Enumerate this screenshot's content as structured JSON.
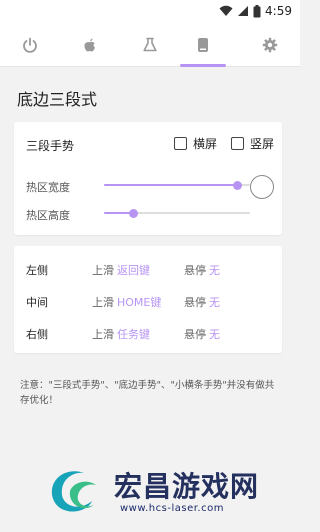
{
  "status_bar": {
    "time": "4:59"
  },
  "tabs": [
    {
      "name": "power",
      "icon": "power-icon"
    },
    {
      "name": "apple",
      "icon": "apple-icon"
    },
    {
      "name": "lab",
      "icon": "flask-icon"
    },
    {
      "name": "gesture",
      "icon": "phone-icon",
      "active": true
    },
    {
      "name": "settings",
      "icon": "gear-icon"
    }
  ],
  "page": {
    "title": "底边三段式"
  },
  "gesture_card": {
    "title": "三段手势",
    "options": {
      "landscape": "横屏",
      "portrait": "竖屏"
    },
    "hot_width": {
      "label": "热区宽度",
      "value": 0.91
    },
    "hot_height": {
      "label": "热区高度",
      "value": 0.2
    }
  },
  "actions": [
    {
      "side": "左侧",
      "swipe_label": "上滑",
      "swipe_value": "返回键",
      "hover_label": "悬停",
      "hover_value": "无"
    },
    {
      "side": "中间",
      "swipe_label": "上滑",
      "swipe_value": "HOME键",
      "hover_label": "悬停",
      "hover_value": "无"
    },
    {
      "side": "右侧",
      "swipe_label": "上滑",
      "swipe_value": "任务键",
      "hover_label": "悬停",
      "hover_value": "无"
    }
  ],
  "note": "注意：\"三段式手势\"、\"底边手势\"、\"小横条手势\"并没有做共存优化！",
  "watermark": {
    "brand": "宏昌游戏网",
    "url": "www.hcs-laser.com"
  },
  "colors": {
    "accent": "#b794f4",
    "background": "#f2f2f2",
    "card": "#ffffff"
  }
}
